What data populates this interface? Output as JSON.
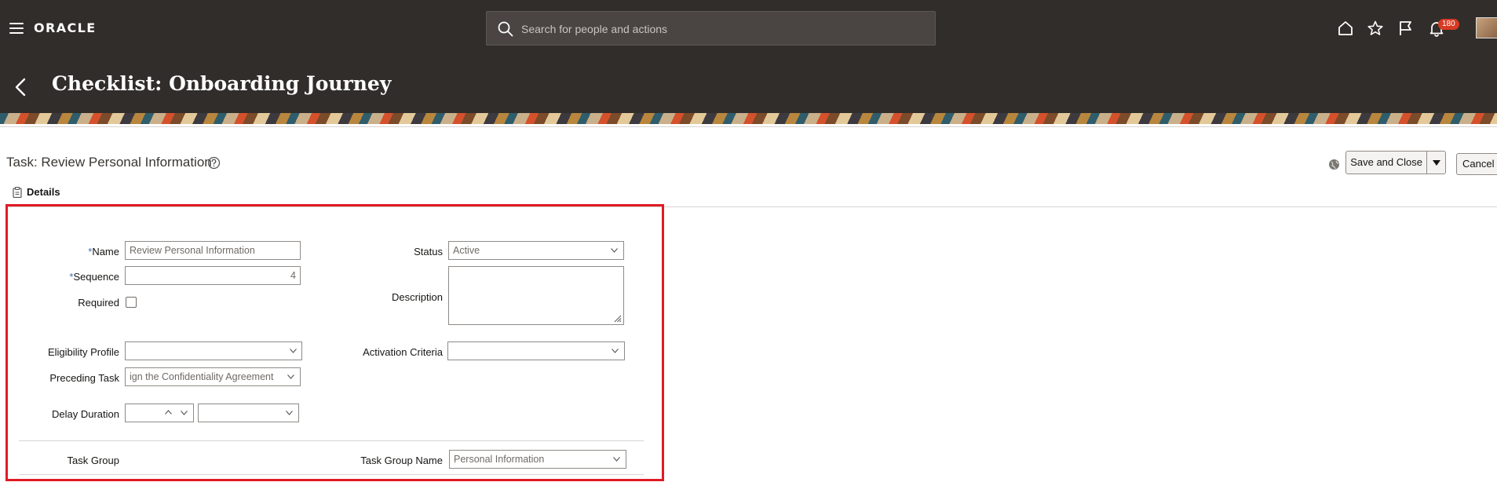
{
  "header": {
    "logo": "ORACLE",
    "search_placeholder": "Search for people and actions",
    "notification_count": "180",
    "page_title": "Checklist: Onboarding Journey"
  },
  "task": {
    "title": "Task: Review Personal Information",
    "save_label": "Save and Close",
    "cancel_label": "Cancel",
    "details_tab": "Details"
  },
  "form": {
    "name_label": "Name",
    "name_value": "Review Personal Information",
    "sequence_label": "Sequence",
    "sequence_value": "4",
    "required_label": "Required",
    "eligibility_label": "Eligibility Profile",
    "preceding_label": "Preceding Task",
    "preceding_value": "ign the Confidentiality Agreement",
    "delay_label": "Delay Duration",
    "status_label": "Status",
    "status_value": "Active",
    "description_label": "Description",
    "activation_label": "Activation Criteria",
    "task_group_label": "Task Group",
    "task_group_name_label": "Task Group Name",
    "task_group_name_value": "Personal Information",
    "required_marker": "*"
  },
  "icons": [
    "menu-icon",
    "search-icon",
    "home-icon",
    "star-icon",
    "flag-icon",
    "bell-icon",
    "avatar",
    "back-arrow-icon",
    "help-icon",
    "globe-icon",
    "clipboard-icon",
    "chevron-down-icon",
    "chevron-up-icon",
    "resize-grip-icon"
  ],
  "colors": {
    "header_bg": "#312d2a",
    "highlight_border": "#e01b24",
    "badge": "#d63b25",
    "required_marker": "#3d6fa8"
  }
}
